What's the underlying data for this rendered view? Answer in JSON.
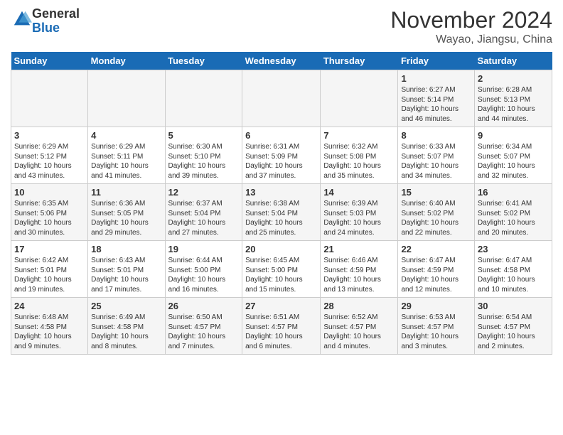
{
  "header": {
    "logo_general": "General",
    "logo_blue": "Blue",
    "title": "November 2024",
    "location": "Wayao, Jiangsu, China"
  },
  "days_of_week": [
    "Sunday",
    "Monday",
    "Tuesday",
    "Wednesday",
    "Thursday",
    "Friday",
    "Saturday"
  ],
  "weeks": [
    [
      {
        "day": "",
        "info": ""
      },
      {
        "day": "",
        "info": ""
      },
      {
        "day": "",
        "info": ""
      },
      {
        "day": "",
        "info": ""
      },
      {
        "day": "",
        "info": ""
      },
      {
        "day": "1",
        "info": "Sunrise: 6:27 AM\nSunset: 5:14 PM\nDaylight: 10 hours\nand 46 minutes."
      },
      {
        "day": "2",
        "info": "Sunrise: 6:28 AM\nSunset: 5:13 PM\nDaylight: 10 hours\nand 44 minutes."
      }
    ],
    [
      {
        "day": "3",
        "info": "Sunrise: 6:29 AM\nSunset: 5:12 PM\nDaylight: 10 hours\nand 43 minutes."
      },
      {
        "day": "4",
        "info": "Sunrise: 6:29 AM\nSunset: 5:11 PM\nDaylight: 10 hours\nand 41 minutes."
      },
      {
        "day": "5",
        "info": "Sunrise: 6:30 AM\nSunset: 5:10 PM\nDaylight: 10 hours\nand 39 minutes."
      },
      {
        "day": "6",
        "info": "Sunrise: 6:31 AM\nSunset: 5:09 PM\nDaylight: 10 hours\nand 37 minutes."
      },
      {
        "day": "7",
        "info": "Sunrise: 6:32 AM\nSunset: 5:08 PM\nDaylight: 10 hours\nand 35 minutes."
      },
      {
        "day": "8",
        "info": "Sunrise: 6:33 AM\nSunset: 5:07 PM\nDaylight: 10 hours\nand 34 minutes."
      },
      {
        "day": "9",
        "info": "Sunrise: 6:34 AM\nSunset: 5:07 PM\nDaylight: 10 hours\nand 32 minutes."
      }
    ],
    [
      {
        "day": "10",
        "info": "Sunrise: 6:35 AM\nSunset: 5:06 PM\nDaylight: 10 hours\nand 30 minutes."
      },
      {
        "day": "11",
        "info": "Sunrise: 6:36 AM\nSunset: 5:05 PM\nDaylight: 10 hours\nand 29 minutes."
      },
      {
        "day": "12",
        "info": "Sunrise: 6:37 AM\nSunset: 5:04 PM\nDaylight: 10 hours\nand 27 minutes."
      },
      {
        "day": "13",
        "info": "Sunrise: 6:38 AM\nSunset: 5:04 PM\nDaylight: 10 hours\nand 25 minutes."
      },
      {
        "day": "14",
        "info": "Sunrise: 6:39 AM\nSunset: 5:03 PM\nDaylight: 10 hours\nand 24 minutes."
      },
      {
        "day": "15",
        "info": "Sunrise: 6:40 AM\nSunset: 5:02 PM\nDaylight: 10 hours\nand 22 minutes."
      },
      {
        "day": "16",
        "info": "Sunrise: 6:41 AM\nSunset: 5:02 PM\nDaylight: 10 hours\nand 20 minutes."
      }
    ],
    [
      {
        "day": "17",
        "info": "Sunrise: 6:42 AM\nSunset: 5:01 PM\nDaylight: 10 hours\nand 19 minutes."
      },
      {
        "day": "18",
        "info": "Sunrise: 6:43 AM\nSunset: 5:01 PM\nDaylight: 10 hours\nand 17 minutes."
      },
      {
        "day": "19",
        "info": "Sunrise: 6:44 AM\nSunset: 5:00 PM\nDaylight: 10 hours\nand 16 minutes."
      },
      {
        "day": "20",
        "info": "Sunrise: 6:45 AM\nSunset: 5:00 PM\nDaylight: 10 hours\nand 15 minutes."
      },
      {
        "day": "21",
        "info": "Sunrise: 6:46 AM\nSunset: 4:59 PM\nDaylight: 10 hours\nand 13 minutes."
      },
      {
        "day": "22",
        "info": "Sunrise: 6:47 AM\nSunset: 4:59 PM\nDaylight: 10 hours\nand 12 minutes."
      },
      {
        "day": "23",
        "info": "Sunrise: 6:47 AM\nSunset: 4:58 PM\nDaylight: 10 hours\nand 10 minutes."
      }
    ],
    [
      {
        "day": "24",
        "info": "Sunrise: 6:48 AM\nSunset: 4:58 PM\nDaylight: 10 hours\nand 9 minutes."
      },
      {
        "day": "25",
        "info": "Sunrise: 6:49 AM\nSunset: 4:58 PM\nDaylight: 10 hours\nand 8 minutes."
      },
      {
        "day": "26",
        "info": "Sunrise: 6:50 AM\nSunset: 4:57 PM\nDaylight: 10 hours\nand 7 minutes."
      },
      {
        "day": "27",
        "info": "Sunrise: 6:51 AM\nSunset: 4:57 PM\nDaylight: 10 hours\nand 6 minutes."
      },
      {
        "day": "28",
        "info": "Sunrise: 6:52 AM\nSunset: 4:57 PM\nDaylight: 10 hours\nand 4 minutes."
      },
      {
        "day": "29",
        "info": "Sunrise: 6:53 AM\nSunset: 4:57 PM\nDaylight: 10 hours\nand 3 minutes."
      },
      {
        "day": "30",
        "info": "Sunrise: 6:54 AM\nSunset: 4:57 PM\nDaylight: 10 hours\nand 2 minutes."
      }
    ]
  ]
}
